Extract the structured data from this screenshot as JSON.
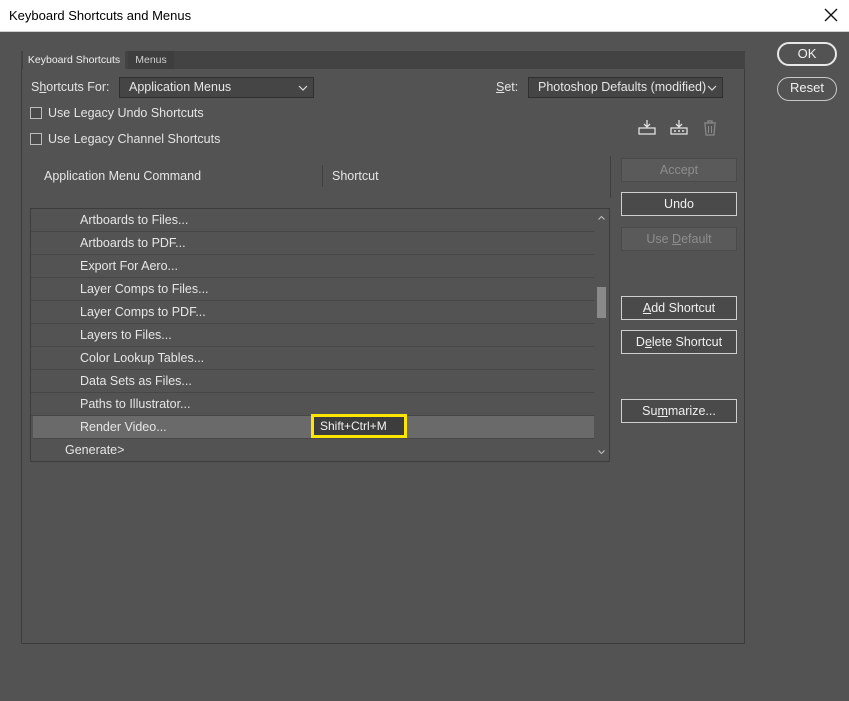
{
  "window": {
    "title": "Keyboard Shortcuts and Menus"
  },
  "tabs": [
    {
      "label": "Keyboard Shortcuts",
      "active": true
    },
    {
      "label": "Menus",
      "active": false
    }
  ],
  "shortcuts_for": {
    "label_pre": "S",
    "label_u": "h",
    "label_post": "ortcuts For:",
    "value": "Application Menus"
  },
  "set": {
    "label_u": "S",
    "label_post": "et:",
    "value": "Photoshop Defaults (modified)"
  },
  "checkboxes": [
    {
      "label": "Use Legacy Undo Shortcuts",
      "checked": false
    },
    {
      "label": "Use Legacy Channel Shortcuts",
      "checked": false
    }
  ],
  "icons": {
    "save": "save-set-icon",
    "save_as": "save-set-as-icon",
    "delete": "delete-set-icon"
  },
  "columns": {
    "command": "Application Menu Command",
    "shortcut": "Shortcut"
  },
  "rows": [
    {
      "label": "Artboards to Files...",
      "type": "item",
      "shortcut": ""
    },
    {
      "label": "Artboards to PDF...",
      "type": "item",
      "shortcut": ""
    },
    {
      "label": "Export For Aero...",
      "type": "item",
      "shortcut": ""
    },
    {
      "label": "Layer Comps to Files...",
      "type": "item",
      "shortcut": ""
    },
    {
      "label": "Layer Comps to PDF...",
      "type": "item",
      "shortcut": ""
    },
    {
      "label": "Layers to Files...",
      "type": "item",
      "shortcut": ""
    },
    {
      "label": "Color Lookup Tables...",
      "type": "item",
      "shortcut": ""
    },
    {
      "label": "Data Sets as Files...",
      "type": "item",
      "shortcut": ""
    },
    {
      "label": "Paths to Illustrator...",
      "type": "item",
      "shortcut": ""
    },
    {
      "label": "Render Video...",
      "type": "item",
      "shortcut": "Shift+Ctrl+M",
      "selected": true
    },
    {
      "label": "Generate>",
      "type": "group",
      "shortcut": ""
    }
  ],
  "buttons": {
    "ok": "OK",
    "reset": "Reset",
    "accept": "Accept",
    "undo": "Undo",
    "use_default_pre": "Use ",
    "use_default_u": "D",
    "use_default_post": "efault",
    "add_shortcut_u": "A",
    "add_shortcut_post": "dd Shortcut",
    "delete_shortcut_pre": "D",
    "delete_shortcut_u": "e",
    "delete_shortcut_post": "lete Shortcut",
    "summarize_pre": "Su",
    "summarize_u": "m",
    "summarize_post": "marize..."
  },
  "colors": {
    "highlight": "#ffe600",
    "background": "#535353"
  }
}
